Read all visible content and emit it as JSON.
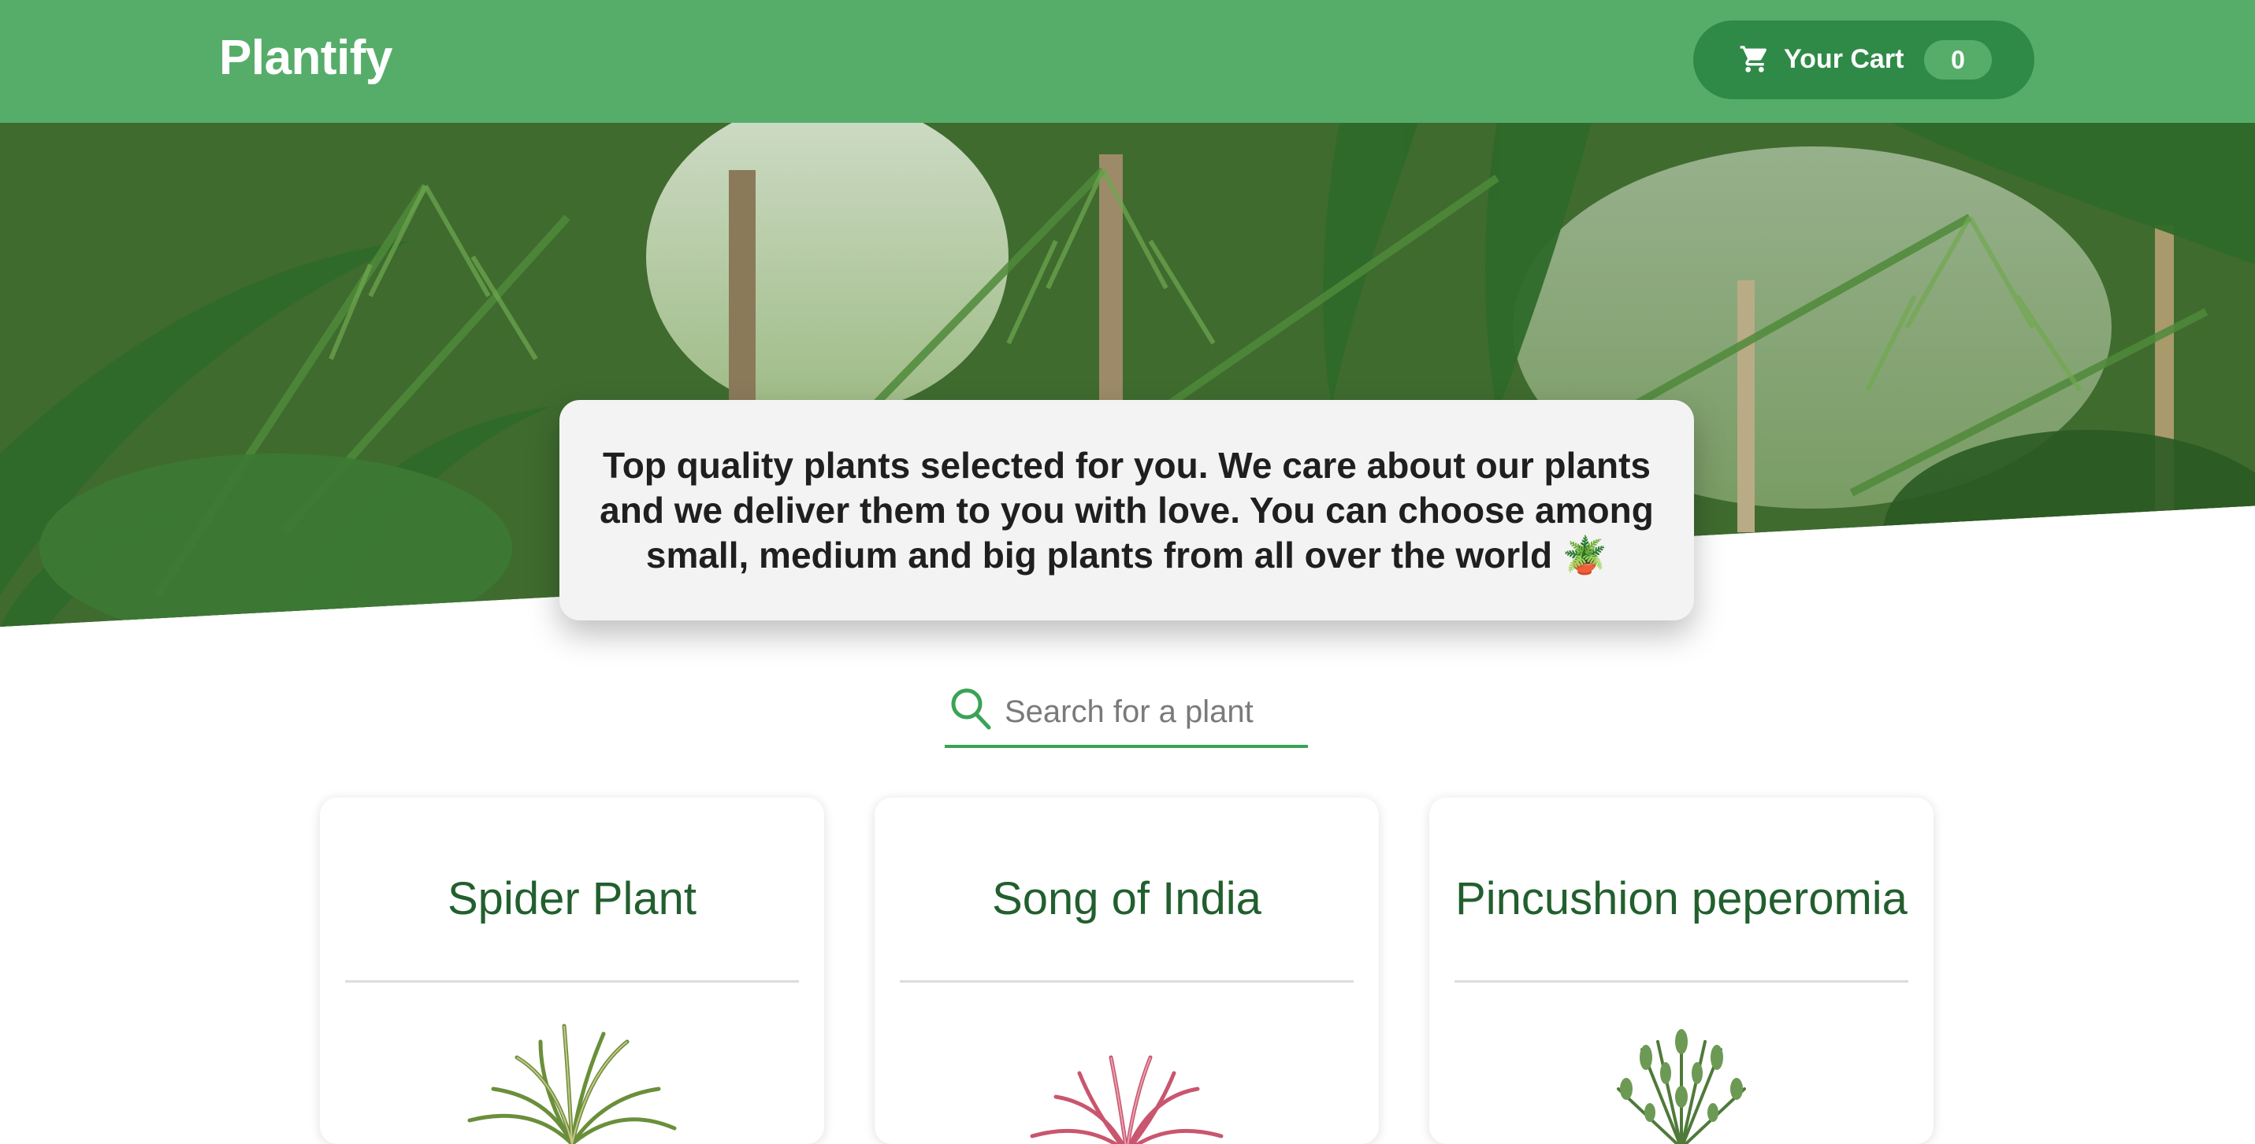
{
  "header": {
    "brand": "Plantify",
    "cart_label": "Your Cart",
    "cart_count": "0",
    "background_color": "#56ad6a",
    "cart_button_color": "#2f8a47",
    "cart_icon": "shopping-cart-icon"
  },
  "hero": {
    "tagline": "Top quality plants selected for you. We care about our plants and we deliver them to you with love. You can choose among small, medium and big plants from all over the world 🪴",
    "background_image": "tropical-palm-leaves"
  },
  "search": {
    "placeholder": "Search for a plant",
    "value": "",
    "icon": "search-icon",
    "accent_color": "#3aa356"
  },
  "products": [
    {
      "name": "Spider Plant",
      "image": "spider-plant-image"
    },
    {
      "name": "Song of India",
      "image": "song-of-india-image"
    },
    {
      "name": "Pincushion peperomia",
      "image": "pincushion-peperomia-image"
    }
  ]
}
